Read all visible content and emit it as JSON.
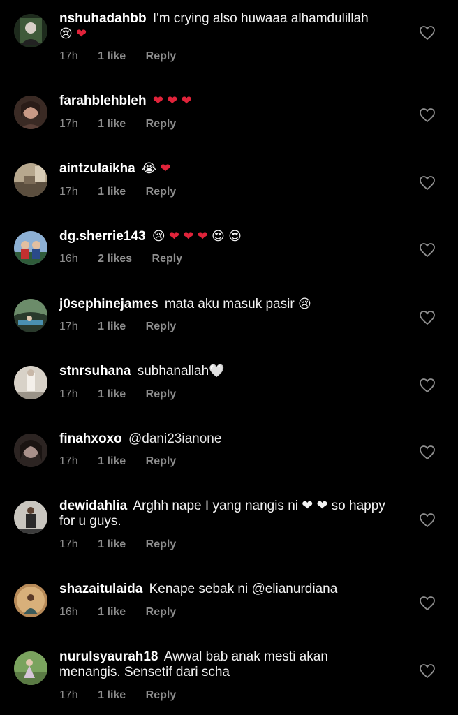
{
  "comments": [
    {
      "username": "nshuhadahbb",
      "text": "I'm crying also huwaaa alhamdulillah",
      "emojis": [
        "😢",
        "❤"
      ],
      "time": "17h",
      "likes": "1 like",
      "reply": "Reply",
      "avatar_colors": [
        "#3f5a3a",
        "#1e2b1d"
      ]
    },
    {
      "username": "farahblehbleh",
      "text": "",
      "emojis": [
        "❤",
        "❤",
        "❤"
      ],
      "time": "17h",
      "likes": "1 like",
      "reply": "Reply",
      "avatar_colors": [
        "#c99a86",
        "#3a2a24"
      ]
    },
    {
      "username": "aintzulaikha",
      "text": "",
      "emojis": [
        "😭",
        "❤"
      ],
      "time": "17h",
      "likes": "1 like",
      "reply": "Reply",
      "avatar_colors": [
        "#b7a88e",
        "#5b4e3e"
      ]
    },
    {
      "username": "dg.sherrie143",
      "text": "",
      "emojis": [
        "😢",
        "❤",
        "❤",
        "❤",
        "😍",
        "😍"
      ],
      "time": "16h",
      "likes": "2 likes",
      "reply": "Reply",
      "avatar_colors": [
        "#8db0d4",
        "#2f5b3a"
      ]
    },
    {
      "username": "j0sephinejames",
      "text": "mata aku masuk pasir",
      "emojis": [
        "😢"
      ],
      "time": "17h",
      "likes": "1 like",
      "reply": "Reply",
      "avatar_colors": [
        "#6c8c6a",
        "#2a3a2c"
      ]
    },
    {
      "username": "stnrsuhana",
      "text": "subhanallah",
      "emojis": [
        "🤍"
      ],
      "time": "17h",
      "likes": "1 like",
      "reply": "Reply",
      "avatar_colors": [
        "#d8d2c8",
        "#9a9388"
      ]
    },
    {
      "username": "finahxoxo",
      "text": "@dani23ianone",
      "emojis": [],
      "time": "17h",
      "likes": "1 like",
      "reply": "Reply",
      "avatar_colors": [
        "#a8908a",
        "#2c2422"
      ]
    },
    {
      "username": "dewidahlia",
      "text": "Arghh nape I yang nangis ni ❤ ❤ so happy for u guys.",
      "emojis": [],
      "time": "17h",
      "likes": "1 like",
      "reply": "Reply",
      "avatar_colors": [
        "#c9c6bf",
        "#3b3b3b"
      ]
    },
    {
      "username": "shazaitulaida",
      "text": "Kenape sebak ni @elianurdiana",
      "emojis": [],
      "time": "16h",
      "likes": "1 like",
      "reply": "Reply",
      "avatar_colors": [
        "#b78a58",
        "#3a5a5a"
      ]
    },
    {
      "username": "nurulsyaurah18",
      "text": "Awwal bab anak mesti akan menangis. Sensetif dari scha",
      "emojis": [],
      "time": "17h",
      "likes": "1 like",
      "reply": "Reply",
      "avatar_colors": [
        "#7aa35e",
        "#d6c6d8"
      ]
    }
  ],
  "colors": {
    "background": "#000000",
    "text": "#f2f2f2",
    "meta": "#8e8e8e",
    "heart_emoji": "#e0233a"
  },
  "icons": {
    "like": "heart-outline-icon"
  }
}
